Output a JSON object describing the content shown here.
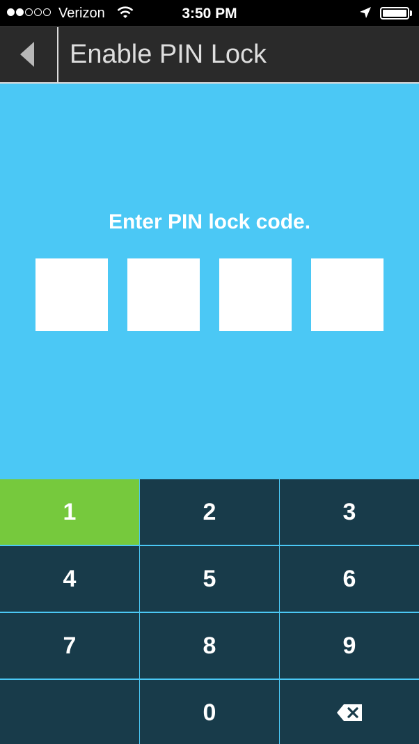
{
  "status_bar": {
    "carrier": "Verizon",
    "time": "3:50 PM",
    "signal_bars_filled": 2,
    "signal_bars_total": 5,
    "battery_level": 1.0
  },
  "nav": {
    "title": "Enable PIN Lock",
    "back_icon": "back-arrow-icon"
  },
  "pin": {
    "prompt": "Enter PIN lock code.",
    "digits_entered": 0,
    "box_count": 4
  },
  "keypad": {
    "keys": [
      "1",
      "2",
      "3",
      "4",
      "5",
      "6",
      "7",
      "8",
      "9",
      "",
      "0",
      ""
    ],
    "active_key": "1",
    "backspace_icon": "backspace-icon"
  },
  "colors": {
    "pin_background": "#4bc8f5",
    "key_background": "#183b4a",
    "key_active": "#76c93d",
    "nav_background": "#2a2a2a"
  }
}
